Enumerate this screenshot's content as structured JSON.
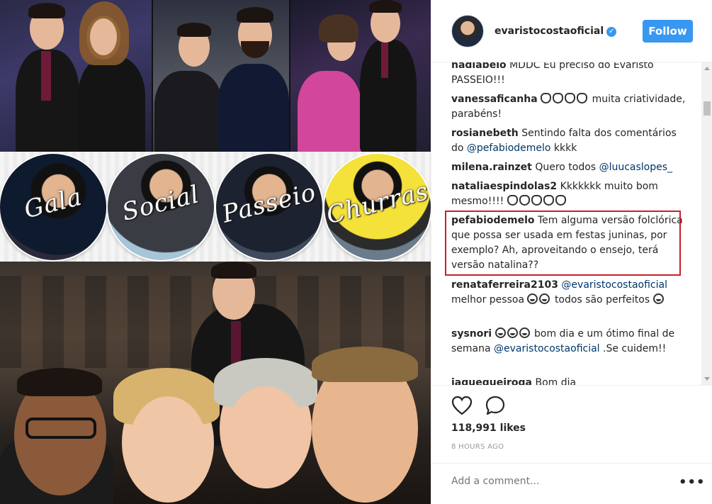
{
  "post": {
    "circles": [
      "Gala",
      "Social",
      "Passeio",
      "Churras"
    ]
  },
  "header": {
    "username": "evaristocostaoficial",
    "follow_label": "Follow"
  },
  "comments": [
    {
      "user": "nadiabelo",
      "text": "MDDC Eu preciso do Evaristo PASSEIO!!!"
    },
    {
      "user": "vanessaficanha",
      "text": "muita criatividade, parabéns!"
    },
    {
      "user": "rosianebeth",
      "text_a": "Sentindo falta dos comentários do",
      "mention": "@pefabiodemelo",
      "text_b": "kkkk"
    },
    {
      "user": "milena.rainzet",
      "text_a": "Quero todos",
      "mention": "@luucaslopes_"
    },
    {
      "user": "nataliaespindolas2",
      "text_a": "Kkkkkkk muito bom",
      "text_b": "mesmo!!!!"
    },
    {
      "user": "pefabiodemelo",
      "text": "Tem alguma versão folclórica que possa ser usada em festas juninas, por exemplo? Ah, aproveitando o ensejo, terá versão natalina??"
    },
    {
      "user": "renataferreira2103",
      "mention": "@evaristocostaoficial",
      "text_a": "melhor pessoa",
      "text_b": "todos são perfeitos"
    },
    {
      "user": "sysnori",
      "text_a": "bom dia e um ótimo final de semana",
      "mention": "@evaristocostaoficial",
      "text_b": ".Se cuidem!!"
    },
    {
      "user": "jaquequeiroga",
      "text": "Bom dia"
    }
  ],
  "actions": {
    "likes": "118,991 likes",
    "time": "8 HOURS AGO"
  },
  "add_comment": {
    "placeholder": "Add a comment...",
    "more": "•••"
  },
  "icons": {
    "verified": "verified-badge-icon",
    "like": "heart-icon",
    "comment": "comment-bubble-icon",
    "more": "more-options-icon"
  },
  "colors": {
    "follow_button": "#3897f0",
    "highlight_box": "#c8202b",
    "mention": "#003569"
  }
}
